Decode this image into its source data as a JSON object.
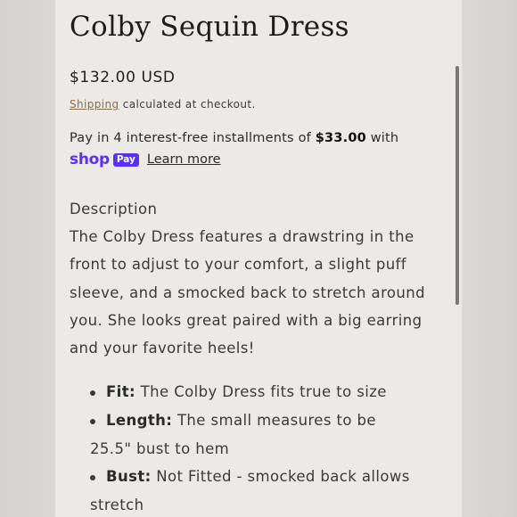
{
  "product": {
    "title": "Colby Sequin Dress",
    "price": "$132.00 USD",
    "shipping_link": "Shipping",
    "shipping_suffix": " calculated at checkout.",
    "installments_prefix": "Pay in 4 interest-free installments of ",
    "installment_amount": "$33.00",
    "installments_suffix": " with",
    "shop_logo": "shop",
    "shop_pay_badge": "Pay",
    "learn_more": "Learn more"
  },
  "description": {
    "heading": "Description",
    "lines": [
      "The Colby Dress features a drawstring in the",
      "front to adjust to your comfort, a slight puff",
      "sleeve, and a smocked back to stretch around",
      "you. She looks great paired with a big earring",
      "and your favorite heels!"
    ]
  },
  "details": [
    {
      "label": "Fit:",
      "text": " The Colby Dress fits true to size",
      "continuation": ""
    },
    {
      "label": "Length:",
      "text": " The small measures to be",
      "continuation": "25.5\" bust to hem"
    },
    {
      "label": "Bust:",
      "text": " Not Fitted - smocked back allows",
      "continuation": "stretch"
    }
  ],
  "colors": {
    "shop_pay": "#5a31f4",
    "shipping_link": "#8f6a48",
    "panel_background": "#ebeae6"
  }
}
